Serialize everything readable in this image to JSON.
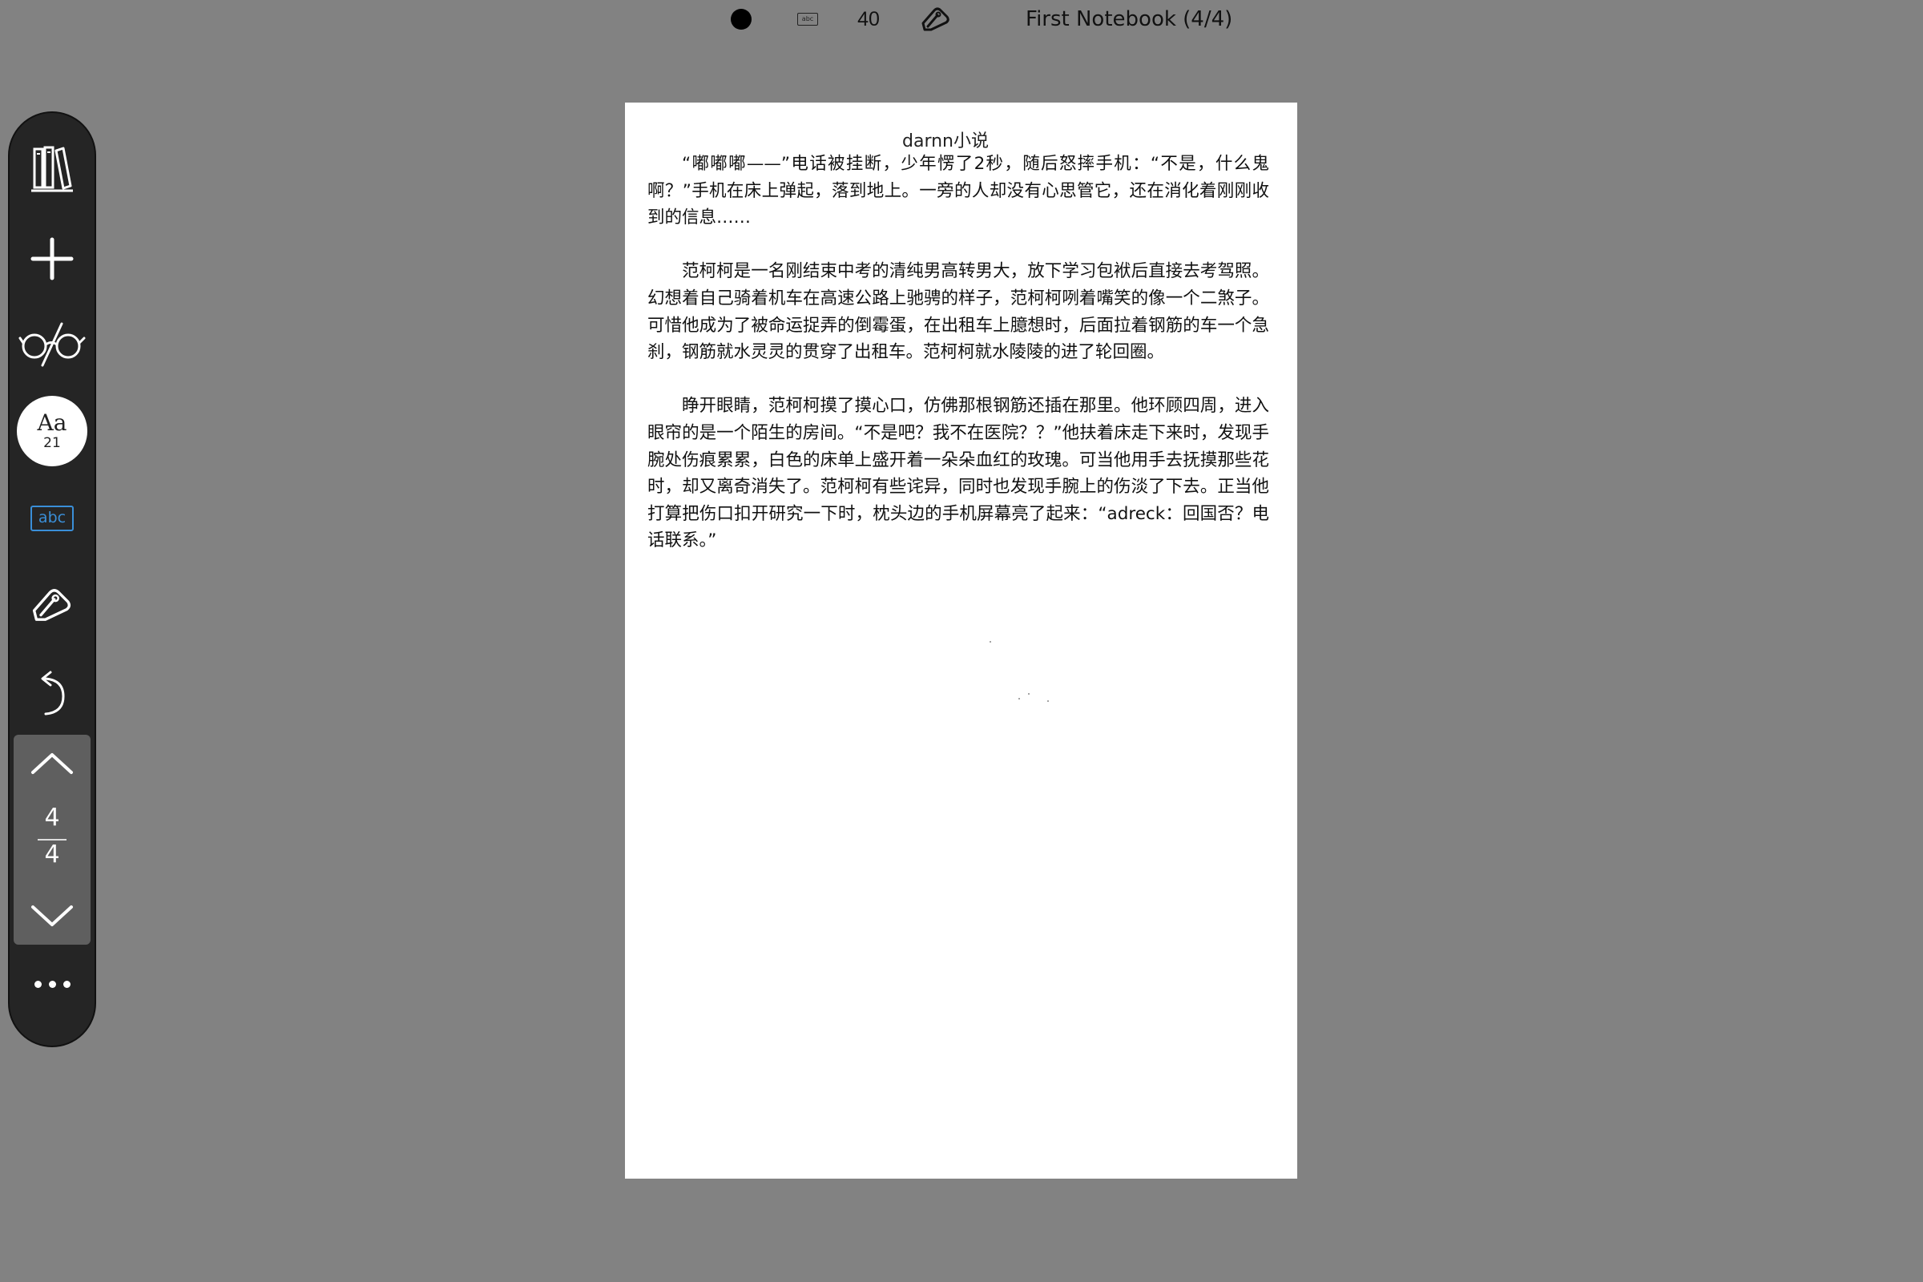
{
  "topbar": {
    "pen_size": "40",
    "notebook_title": "First Notebook (4/4)",
    "icons": {
      "color_dot": "black-dot-icon",
      "text_mode": "abc-text-icon",
      "pen": "pen-tool-icon"
    }
  },
  "sidebar": {
    "icons": {
      "library": "library-books-icon",
      "add": "plus-icon",
      "view": "glasses-icon",
      "text": "abc-text-icon",
      "pen": "pen-tool-icon",
      "undo": "undo-icon",
      "page_up": "chevron-up-icon",
      "page_down": "chevron-down-icon",
      "more": "more-dots-icon"
    },
    "font": {
      "label": "Aa",
      "size": "21"
    },
    "text_button_label": "abc",
    "page_nav": {
      "current": "4",
      "total": "4"
    },
    "accent_color": "#3a8fd8"
  },
  "document": {
    "title": "darnn小说",
    "paragraphs": [
      "“嘟嘟嘟——”电话被挂断，少年愣了2秒，随后怒摔手机：“不是，什么鬼啊？”手机在床上弹起，落到地上。一旁的人却没有心思管它，还在消化着刚刚收到的信息……",
      "范柯柯是一名刚结束中考的清纯男高转男大，放下学习包袱后直接去考驾照。幻想着自己骑着机车在高速公路上驰骋的样子，范柯柯咧着嘴笑的像一个二煞子。可惜他成为了被命运捉弄的倒霉蛋，在出租车上臆想时，后面拉着钢筋的车一个急刹，钢筋就水灵灵的贯穿了出租车。范柯柯就水陵陵的进了轮回圈。",
      "睁开眼睛，范柯柯摸了摸心口，仿佛那根钢筋还插在那里。他环顾四周，进入眼帘的是一个陌生的房间。“不是吧？我不在医院？？”他扶着床走下来时，发现手腕处伤痕累累，白色的床单上盛开着一朵朵血红的玫瑰。可当他用手去抚摸那些花时，却又离奇消失了。范柯柯有些诧异，同时也发现手腕上的伤淡了下去。正当他打算把伤口扣开研究一下时，枕头边的手机屏幕亮了起来：“adreck：回国否？电话联系。”"
    ]
  }
}
